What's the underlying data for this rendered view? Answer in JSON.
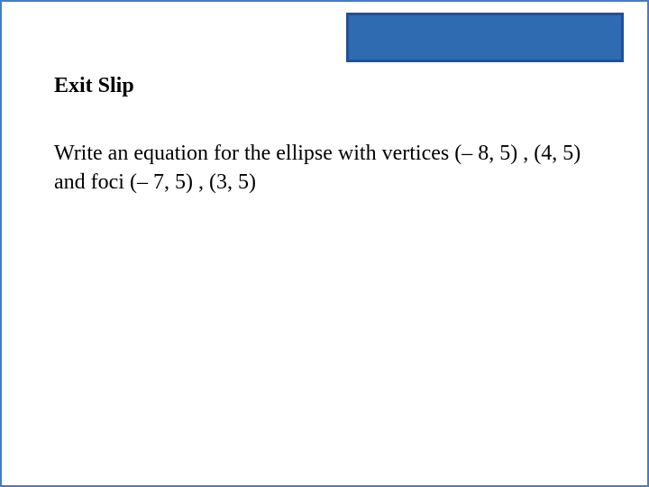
{
  "slide": {
    "heading": "Exit Slip",
    "body": "Write an equation for the ellipse with vertices (– 8, 5) , (4, 5) and foci (– 7, 5) , (3, 5)"
  }
}
